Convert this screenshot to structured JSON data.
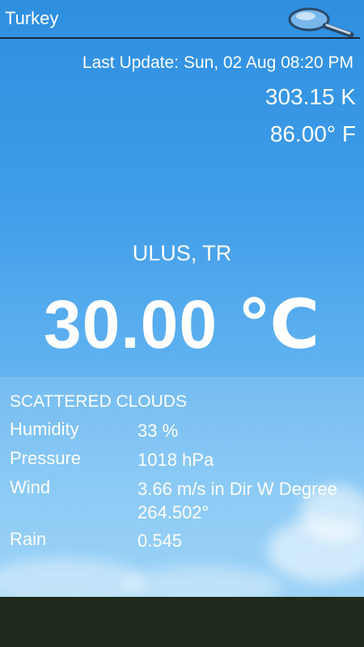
{
  "header": {
    "title": "Turkey",
    "search_icon": "search-icon"
  },
  "update": {
    "last_update": "Last Update: Sun, 02 Aug 08:20 PM",
    "kelvin": "303.15 K",
    "fahrenheit": "86.00° F"
  },
  "location": {
    "city": "ULUS, TR",
    "celsius": "30.00 ℃"
  },
  "details": {
    "condition": "SCATTERED CLOUDS",
    "humidity_label": "Humidity",
    "humidity_value": "33  %",
    "pressure_label": "Pressure",
    "pressure_value": "1018  hPa",
    "wind_label": "Wind",
    "wind_value": "3.66 m/s in Dir W Degree 264.502°",
    "rain_label": "Rain",
    "rain_value": "0.545"
  },
  "colors": {
    "sky_top": "#2e8fe0",
    "sky_bottom": "#8fcdf6",
    "bottom_bar": "#1f2a1c",
    "text": "#ffffff"
  }
}
